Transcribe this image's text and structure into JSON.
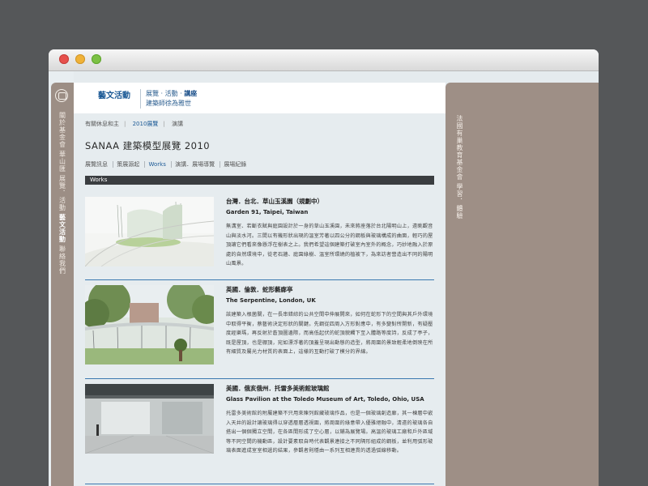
{
  "sidebar_left": {
    "items": [
      "關於基金會",
      "華山匯",
      "展覽．活動",
      "藝文活動",
      "聯絡我們"
    ]
  },
  "sidebar_right": {
    "items": [
      "法國有巢教育基金會",
      "學習．體驗"
    ]
  },
  "topnav": {
    "title": "藝文活動",
    "links_line1": [
      "展覽",
      "活動",
      "講座"
    ],
    "links_line2": "建築師徐為雅世"
  },
  "subnav": {
    "items": [
      "有關休息和主",
      "2010展覽",
      "演講"
    ],
    "selected": "2010展覽"
  },
  "page": {
    "title": "SANAA 建築模型展覽 2010"
  },
  "tabs": {
    "items": [
      "展覽訊息",
      "策展源起",
      "Works",
      "演講．展場導覽",
      "展場紀錄"
    ],
    "selected": "Works"
  },
  "section": {
    "label": "Works"
  },
  "works": [
    {
      "title_zh": "台灣．台北．草山玉溪園（規劃中）",
      "title_en": "Garden 91, Taipei, Taiwan",
      "desc": "無溝室、若斷衣賦與庭園設計於一身的草山玉溪園，未來將座落於台北陽明山上，遠眺觀音山與淡水河。三間以有機形狀出現的溫室芳著以四公分的鋼板與玻璃構成的曲面，輕巧的屋頂讓它們看來像懸浮在樹表之上。我們希望這個建築打破室內室外的概念，巧妙地融入於原處的自然環境中，從老石牆、庭園綠樹、溫室所環繞的植被下，為來訪者營造出不同的陽明山風景。"
    },
    {
      "title_zh": "英國．倫敦．蛇形藝廊亭",
      "title_en": "The Serpentine, London, UK",
      "desc": "該建築入根菌關，在一長串錯綜的公共空間中伸展開來，如何在蛇形下的空間與其戶外環境中取得平衡，蔡藝術決定形狀的關鍵。先鋼從四周入方形對應中，有多變對所開新，有疑壓度經樂瑪，再反射於蒼頂圖邊際，而高低起伏的蛇頂貌觸下至入體路等度詩，反成了亭子，既是屋頂，也是棚頂，宛如漂浮著的頂蓋呈現出動態的造型，將周圍的景致輕柔地倒映在所有細質及屬光力材質的表面上，這樣的互動打破了模分的界線。"
    },
    {
      "title_zh": "美國．俄亥俄州．托雷多美術館玻璃館",
      "title_en": "Glass Pavilion at the Toledo Museum of Art, Toledo, Ohio, USA",
      "desc": "托雷多美術館的附屬建築不只用來陳列館藏玻璃作品，也是一個玻璃創造廊，其一棟層中嵌入天井的設計讓玻璃得以穿透層層透視圍，將周圍的綠意帶入優雅絕融中，清遠的玻璃各自搭出一個個獨立空間，在各區間形成了空心層，以鋪為展覽場。高溫的玻璃工廠和戶外區域等不同空間的機動區，設計要素取自時代表觀景連接之不同隔形組成的鋼板，並利用弧形玻璃表面進成室室相遞的結果，參觀者則穩由一系列互相連貫的透過弧線移動。"
    }
  ]
}
